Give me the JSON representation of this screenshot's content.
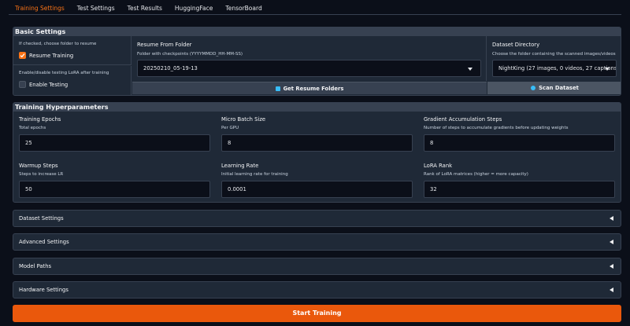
{
  "tabs": [
    "Training Settings",
    "Test Settings",
    "Test Results",
    "HuggingFace",
    "TensorBoard"
  ],
  "basic": {
    "title": "Basic Settings",
    "resume_hint": "If checked, choose folder to resume",
    "resume_label": "Resume Training",
    "resume_checked": true,
    "testing_hint": "Enable/disable testing LoRA after training",
    "testing_label": "Enable Testing",
    "testing_checked": false,
    "resume_folder_title": "Resume From Folder",
    "resume_folder_hint": "Folder with checkpoints (YYYYMMDD_HH-MM-SS)",
    "resume_folder_value": "20250210_05-19-13",
    "dataset_title": "Dataset Directory",
    "dataset_hint": "Choose the folder containing the scanned images/videos",
    "dataset_value": "NightKing (27 images, 0 videos, 27 captions)",
    "get_folders_label": "Get Resume Folders",
    "scan_label": "Scan Dataset"
  },
  "hyper": {
    "title": "Training Hyperparameters",
    "fields": [
      {
        "title": "Training Epochs",
        "hint": "Total epochs",
        "value": "25"
      },
      {
        "title": "Micro Batch Size",
        "hint": "Per GPU",
        "value": "8"
      },
      {
        "title": "Gradient Accumulation Steps",
        "hint": "Number of steps to accumulate gradients before updating weights",
        "value": "8"
      },
      {
        "title": "Warmup Steps",
        "hint": "Steps to increase LR",
        "value": "50"
      },
      {
        "title": "Learning Rate",
        "hint": "Initial learning rate for training",
        "value": "0.0001"
      },
      {
        "title": "LoRA Rank",
        "hint": "Rank of LoRA matrices (higher = more capacity)",
        "value": "32"
      }
    ]
  },
  "accordions": [
    "Dataset Settings",
    "Advanced Settings",
    "Model Paths",
    "Hardware Settings"
  ],
  "start_label": "Start Training",
  "colors": {
    "accent": "#f97316",
    "start_button": "#ea580c",
    "background": "#0b0f19",
    "panel": "#1f2937"
  }
}
